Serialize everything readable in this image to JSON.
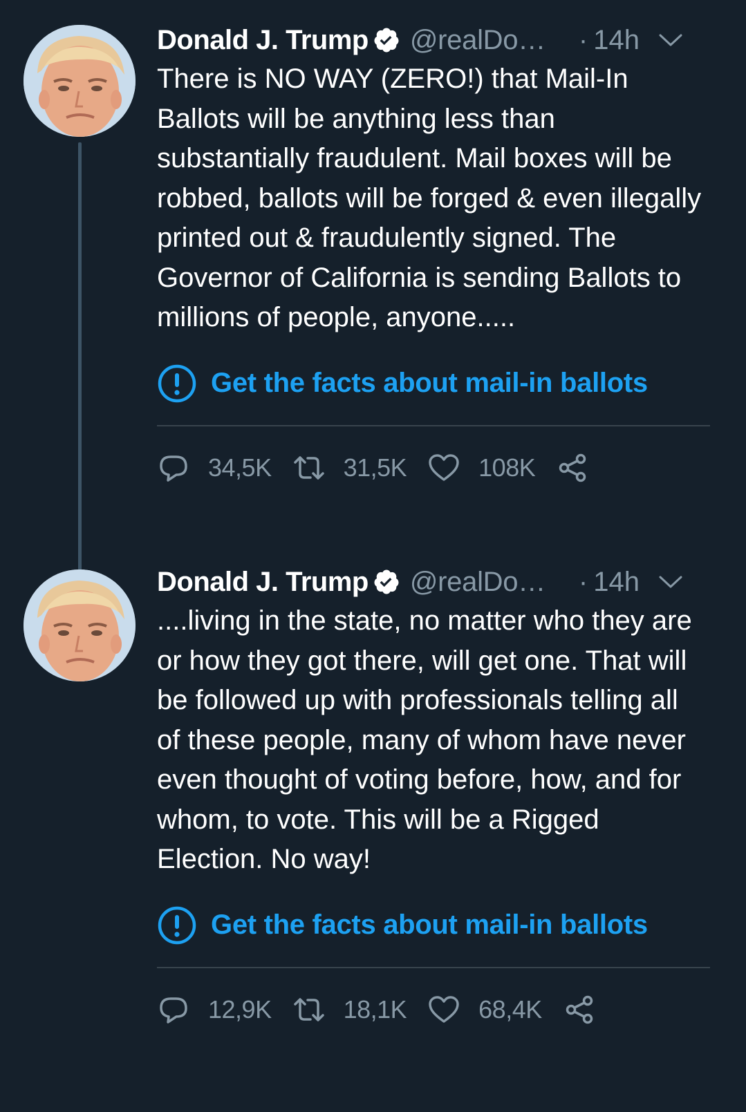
{
  "tweets": [
    {
      "name": "Donald J. Trump",
      "handle": "@realDo…",
      "dot": "·",
      "time": "14h",
      "text": "There is NO WAY (ZERO!) that Mail-In Ballots will be anything less than substantially fraudulent. Mail boxes will be robbed, ballots will be forged & even illegally printed out & fraudulently signed. The Governor of California is sending Ballots to millions of people, anyone.....",
      "facts_label": "Get the facts about mail-in ballots",
      "replies": "34,5K",
      "retweets": "31,5K",
      "likes": "108K"
    },
    {
      "name": "Donald J. Trump",
      "handle": "@realDo…",
      "dot": "·",
      "time": "14h",
      "text": "....living in the state, no matter who they are or how they got there, will get one. That will be followed up with professionals telling all of these people, many of whom have never even thought of voting before, how, and for whom, to vote. This will be a Rigged Election. No way!",
      "facts_label": "Get the facts about mail-in ballots",
      "replies": "12,9K",
      "retweets": "18,1K",
      "likes": "68,4K"
    }
  ],
  "colors": {
    "background": "#15202b",
    "accent": "#1da1f2",
    "secondary_text": "#8899a6",
    "divider": "#38444d",
    "thread_line": "#3d5466"
  },
  "icons": {
    "verified": "verified-badge-icon",
    "caret": "chevron-down-icon",
    "facts": "exclamation-circle-icon",
    "reply": "reply-bubble-icon",
    "retweet": "retweet-icon",
    "like": "heart-icon",
    "share": "share-icon"
  }
}
